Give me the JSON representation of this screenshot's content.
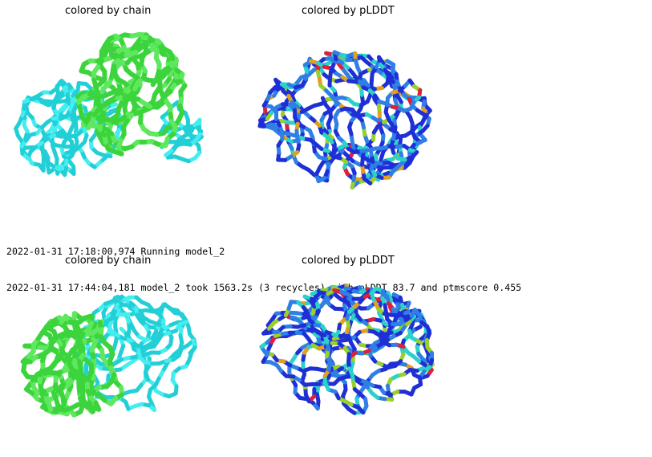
{
  "figure_1": {
    "left_title": "colored by chain",
    "right_title": "colored by pLDDT"
  },
  "log": {
    "lines": [
      "2022-01-31 17:18:00,974 Running model_2",
      "2022-01-31 17:44:04,181 model_2 took 1563.2s (3 recycles) with pLDDT 83.7 and ptmscore 0.455"
    ]
  },
  "figure_2": {
    "left_title": "colored by chain",
    "right_title": "colored by pLDDT"
  },
  "colors": {
    "chain_a": "#3cd43c",
    "chain_a_light": "#5ee85e",
    "chain_b": "#22cfd6",
    "chain_b_light": "#44eef0",
    "plddt_very_high": "#1f2fd6",
    "plddt_high": "#2f7fe6",
    "plddt_mid": "#2ad2c8",
    "plddt_low": "#9ad02a",
    "plddt_very_low": "#e0203a",
    "plddt_orange": "#e0a020"
  }
}
